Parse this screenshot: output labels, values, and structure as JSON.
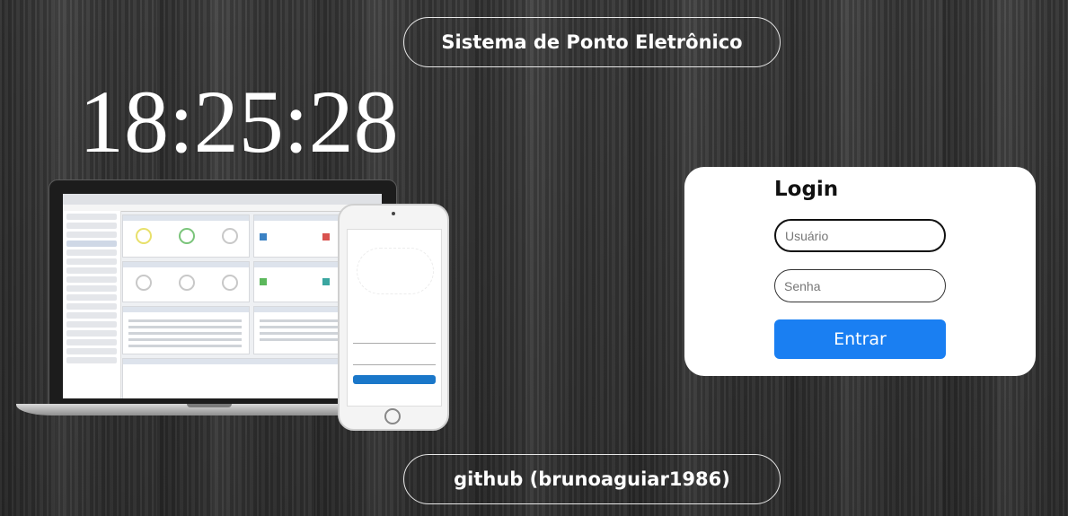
{
  "header": {
    "title": "Sistema de Ponto Eletrônico"
  },
  "clock": {
    "time": "18:25:28"
  },
  "login": {
    "title": "Login",
    "username_placeholder": "Usuário",
    "password_placeholder": "Senha",
    "submit_label": "Entrar"
  },
  "footer": {
    "link_label": "github (brunoaguiar1986)"
  },
  "colors": {
    "accent": "#1a7ff2",
    "background": "#3a3a3a"
  }
}
